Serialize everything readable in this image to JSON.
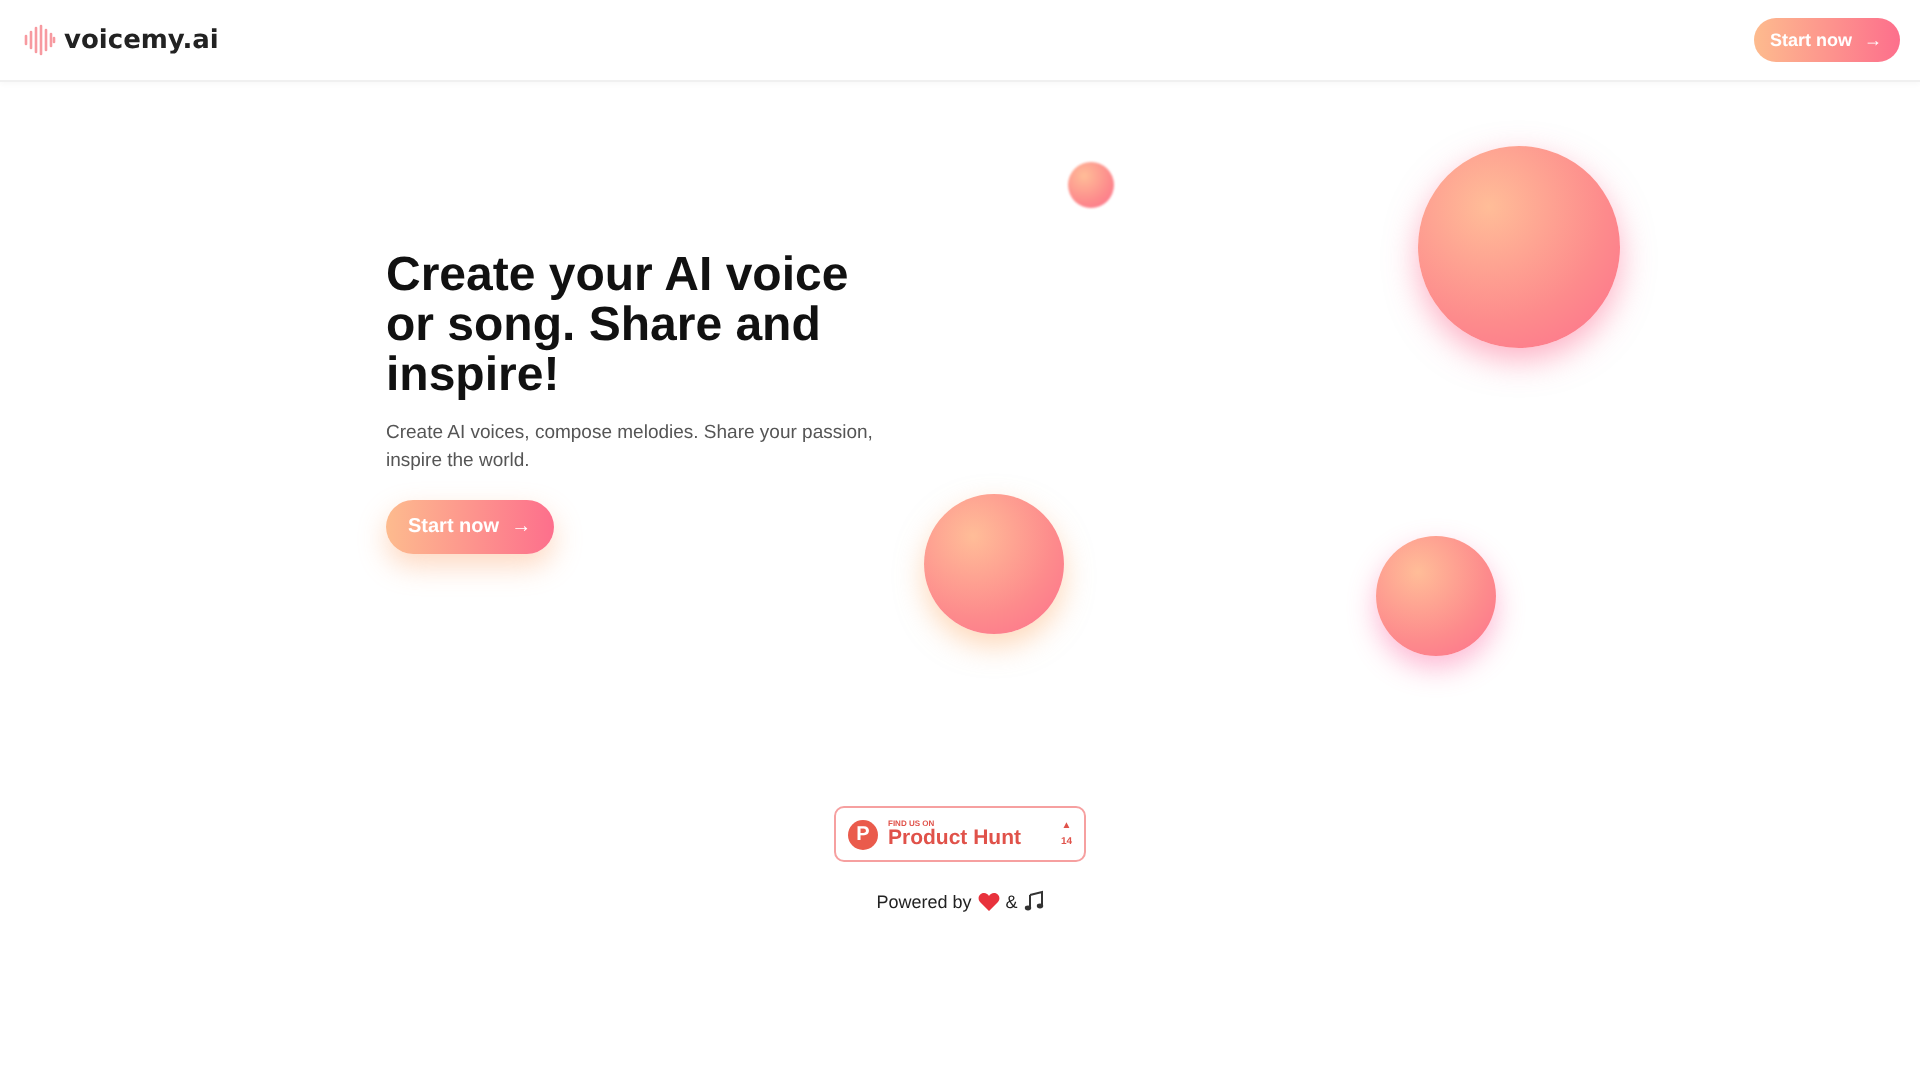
{
  "header": {
    "logo_text": "voicemy.ai",
    "cta": {
      "label": "Start now",
      "icon": "→"
    }
  },
  "hero": {
    "title": "Create your AI voice or song. Share and inspire!",
    "subtitle": "Create AI voices, compose melodies. Share your passion, inspire the world.",
    "cta": {
      "label": "Start now",
      "icon": "→"
    }
  },
  "badge": {
    "logo_letter": "P",
    "eyebrow": "FIND US ON",
    "name": "Product Hunt",
    "arrow": "▲",
    "count": "14"
  },
  "footer": {
    "before": "Powered by",
    "between": "&"
  }
}
